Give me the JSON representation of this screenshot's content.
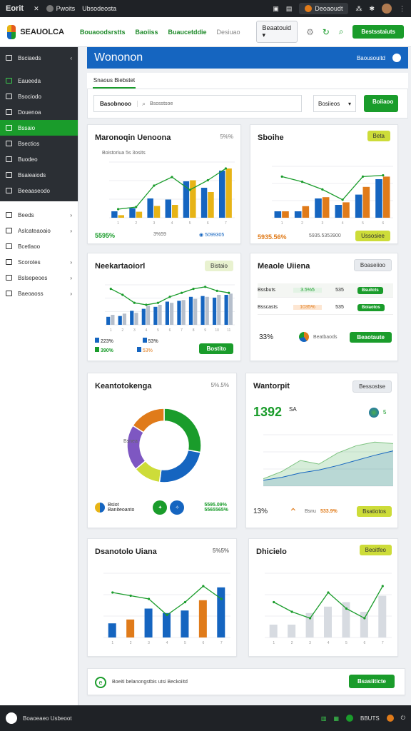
{
  "osbar": {
    "app": "Eorit",
    "tab1": "Pwoits",
    "tab2": "Ubsodeosta",
    "chip_label": "Deoaoudt"
  },
  "header": {
    "brand": "SEAUOLCA",
    "nav": [
      "Bouaoodsrstts",
      "Baoiiss",
      "Buaucetddie",
      "Desiuao"
    ],
    "select_value": "Beaatouid",
    "action_button": "Bestsstaiuts"
  },
  "sidebar": {
    "top_title": "Bsciaeds",
    "items": [
      "Eaueeda",
      "Bsociodo",
      "Douenoa",
      "Bssaio",
      "Bsectios",
      "Buodeo",
      "Bsaieaiods",
      "Beeaaseodo"
    ],
    "active_index": 3,
    "bottom": [
      "Beeds",
      "Aslcateaoaio",
      "Bcetlaoo",
      "Scorotes",
      "Bslsepeoes",
      "Baeoaoss"
    ]
  },
  "main": {
    "banner_title": "Wononon",
    "banner_right": "Baousouitd",
    "tab": "Snaous Biebstet",
    "search_label": "Basobnooo",
    "search_placeholder": "Bsosstsoe",
    "filter_value": "Bosiieos",
    "filter_button": "Boiiaoo"
  },
  "cards": {
    "c1": {
      "title": "Maronoqin Uenoona",
      "meta": "5%%",
      "legend": "Boistoriua 5s 3osits",
      "foot_left": "5595%",
      "foot_mid": "3%59",
      "foot_right": "5099305"
    },
    "c2": {
      "title": "Sboihe",
      "badge": "Beta",
      "foot_left": "5935.56%",
      "foot_mid": "5935.5353900",
      "foot_btn": "Ussosiee"
    },
    "c3": {
      "title": "Neekartaoiorl",
      "badge": "Bistaio",
      "legend": [
        "223%",
        "53%",
        "390%",
        "53%"
      ],
      "btn": "Bostito"
    },
    "c4": {
      "title": "Meaole Uiiena",
      "badge": "Boaseiioo",
      "rows": [
        {
          "name": "Bssbuts",
          "val": "3.5%5",
          "count": "535",
          "action": "Bsuitcts"
        },
        {
          "name": "Bsscasts",
          "val": "1035%",
          "count": "535",
          "action": "Boiaotos"
        }
      ],
      "big": "33%",
      "legend": "Beatbaods",
      "btn": "Beaotaute"
    },
    "c5": {
      "title": "Keantotokenga",
      "meta": "5%.5%",
      "legend": [
        "Bsiot",
        "Baniteoanto"
      ],
      "right_top": "5595.09%",
      "right_bot": "5565565%",
      "slice_label": "Bsnea"
    },
    "c6": {
      "title": "Wantorpit",
      "badge": "Bessostse",
      "big": "1392",
      "big_unit": "SA",
      "val_badge": "5",
      "foot_left": "13%",
      "foot_mid": "Bsnu",
      "foot_mid2": "533.9%",
      "btn": "Bsatiotos"
    },
    "c7": {
      "title": "Dsanotolo Uiana",
      "meta": "5%5%"
    },
    "c8": {
      "title": "Dhicielo",
      "badge": "Beoitfeo"
    }
  },
  "banner_bottom": {
    "text": "Boeiti belanongstbis utsi Beckoiitd",
    "btn": "Bsasiiticte"
  },
  "statusbar": {
    "text": "Boaoeaeo Usbeoot",
    "right": "BBUTS"
  },
  "chart_data": [
    {
      "type": "bar",
      "title": "Maronoqin Uenoona",
      "categories": [
        "1",
        "2",
        "3",
        "4",
        "5",
        "6",
        "7"
      ],
      "series": [
        {
          "values": [
            30,
            45,
            90,
            85,
            170,
            140,
            220
          ]
        },
        {
          "values": [
            12,
            28,
            55,
            60,
            175,
            120,
            230
          ]
        }
      ],
      "line": [
        40,
        50,
        150,
        190,
        130,
        175,
        230
      ],
      "ylim": [
        0,
        260
      ]
    },
    {
      "type": "bar",
      "title": "Sboihe",
      "categories": [
        "1",
        "2",
        "3",
        "4",
        "5",
        "6"
      ],
      "series": [
        {
          "values": [
            25,
            25,
            75,
            50,
            90,
            150
          ]
        },
        {
          "values": [
            25,
            45,
            80,
            60,
            120,
            160
          ]
        }
      ],
      "line": [
        160,
        140,
        110,
        70,
        160,
        165
      ],
      "ylim": [
        0,
        200
      ]
    },
    {
      "type": "bar",
      "title": "Neekartaoiorl",
      "categories": [
        "1",
        "2",
        "3",
        "4",
        "5",
        "6",
        "7",
        "8",
        "9",
        "10",
        "11"
      ],
      "series": [
        {
          "values": [
            20,
            22,
            35,
            40,
            45,
            58,
            60,
            70,
            72,
            68,
            75
          ]
        },
        {
          "values": [
            25,
            28,
            30,
            48,
            50,
            55,
            62,
            65,
            70,
            75,
            78
          ]
        }
      ],
      "line": [
        90,
        75,
        55,
        50,
        55,
        70,
        80,
        90,
        95,
        85,
        80
      ],
      "ylim": [
        0,
        100
      ]
    },
    {
      "type": "pie",
      "title": "Keantotokenga",
      "values": [
        28,
        24,
        12,
        20,
        16
      ],
      "colors": [
        "#1a9c2b",
        "#1565c0",
        "#cddc39",
        "#7e57c2",
        "#e07b1a"
      ]
    },
    {
      "type": "area",
      "title": "Wantorpit",
      "x": [
        1,
        2,
        3,
        4,
        5,
        6,
        7,
        8
      ],
      "series": [
        {
          "values": [
            10,
            20,
            35,
            30,
            45,
            55,
            60,
            58
          ]
        },
        {
          "values": [
            8,
            12,
            18,
            22,
            28,
            35,
            42,
            48
          ]
        }
      ],
      "ylim": [
        0,
        70
      ]
    },
    {
      "type": "bar",
      "title": "Dsanotolo Uiana",
      "categories": [
        "1",
        "2",
        "3",
        "4",
        "5",
        "6",
        "7"
      ],
      "values": [
        22,
        28,
        45,
        38,
        42,
        58,
        78
      ],
      "colors": [
        "#1565c0",
        "#e07b1a",
        "#1565c0",
        "#1565c0",
        "#1565c0",
        "#e07b1a",
        "#1565c0"
      ],
      "line": [
        70,
        65,
        60,
        35,
        55,
        80,
        60
      ],
      "ylim": [
        0,
        100
      ]
    },
    {
      "type": "bar",
      "title": "Dhicielo",
      "categories": [
        "1",
        "2",
        "3",
        "4",
        "5",
        "6",
        "7"
      ],
      "values": [
        20,
        20,
        38,
        48,
        55,
        40,
        65
      ],
      "line": [
        55,
        40,
        30,
        70,
        45,
        30,
        80
      ],
      "ylim": [
        0,
        100
      ]
    }
  ]
}
